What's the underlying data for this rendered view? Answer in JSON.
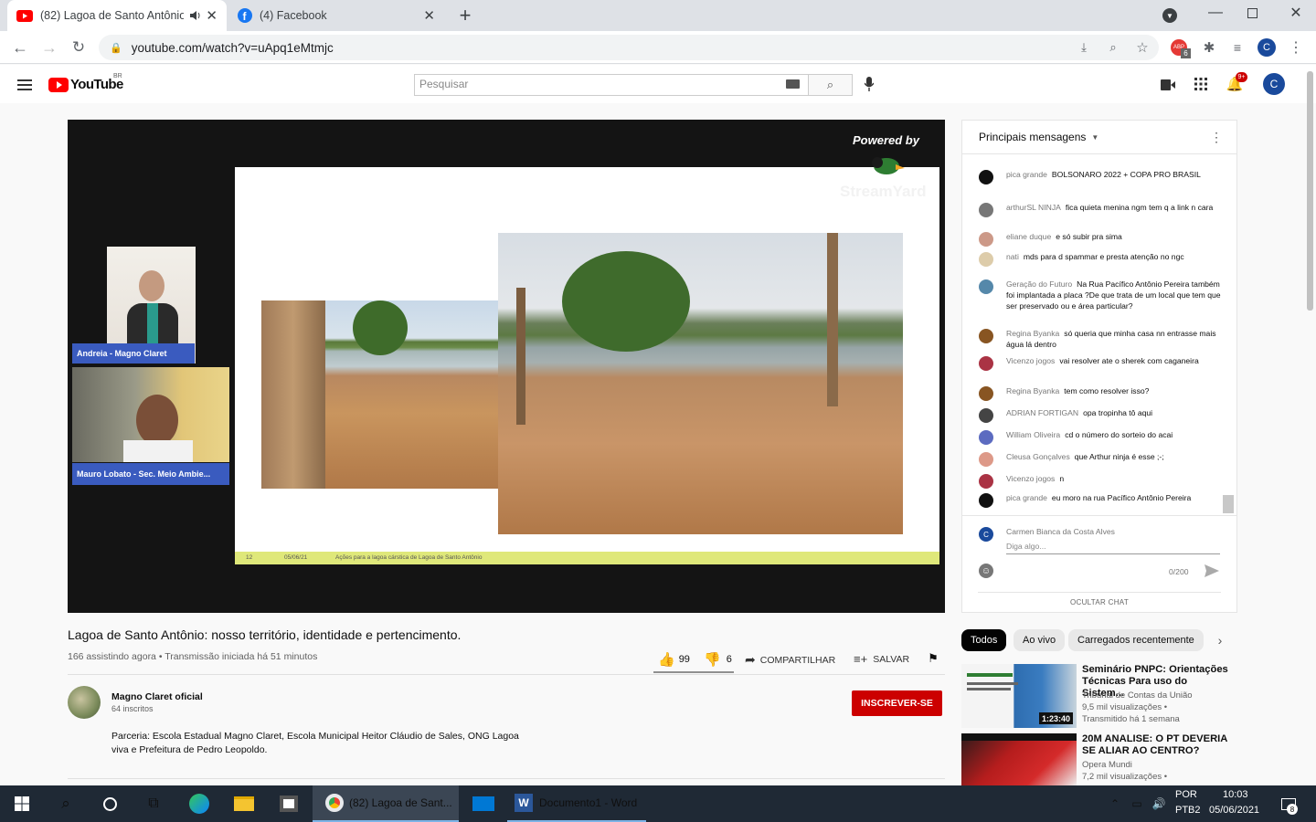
{
  "browser": {
    "tabs": [
      {
        "title": "(82) Lagoa de Santo Antônio",
        "icon": "youtube-icon"
      },
      {
        "title": "(4) Facebook",
        "icon": "facebook-icon"
      }
    ],
    "url": "youtube.com/watch?v=uApq1eMtmjc",
    "profile_initial": "C",
    "ext_badge": "6"
  },
  "yt": {
    "logo_text": "YouTube",
    "region": "BR",
    "search_placeholder": "Pesquisar",
    "notif_count": "9+",
    "avatar_initial": "C"
  },
  "player": {
    "powered_by": "Powered by",
    "streamyard": "StreamYard",
    "guest1": "Andreia - Magno Claret",
    "guest2": "Mauro Lobato - Sec. Meio Ambie...",
    "slide_page": "12",
    "slide_date": "05/06/21",
    "slide_caption": "Ações para a lagoa cárstica de Lagoa de Santo Antônio"
  },
  "video": {
    "title": "Lagoa de Santo Antônio: nosso território, identidade e pertencimento.",
    "meta": "166 assistindo agora • Transmissão iniciada há 51 minutos",
    "likes": "99",
    "dislikes": "6",
    "share": "COMPARTILHAR",
    "save": "SALVAR",
    "channel": "Magno Claret oficial",
    "subs": "64 inscritos",
    "subscribe": "INSCREVER-SE",
    "desc1": "Parceria: Escola Estadual Magno Claret, Escola Municipal  Heitor Cláudio de Sales, ONG Lagoa",
    "desc2": "viva e Prefeitura de Pedro Leopoldo."
  },
  "chat": {
    "header": "Principais mensagens",
    "messages": [
      {
        "author": "pica grande",
        "text": "BOLSONARO 2022 + COPA PRO BRASIL",
        "color": "#111"
      },
      {
        "author": "arthurSL NINJA",
        "text": "fica quieta menina ngm tem q a link n cara",
        "color": "#777"
      },
      {
        "author": "eliane duque",
        "text": "e só subir pra sima",
        "color": "#c98"
      },
      {
        "author": "nati",
        "text": "mds para d spammar e presta atenção no ngc",
        "color": "#dca"
      },
      {
        "author": "Geração do Futuro",
        "text": "Na Rua Pacífico Antônio Pereira também foi implantada a placa ?De que trata de um local que tem que ser preservado ou e área particular?",
        "color": "#58a"
      },
      {
        "author": "Regina Byanka",
        "text": "só queria que minha casa nn entrasse mais água lá dentro",
        "color": "#852"
      },
      {
        "author": "Vicenzo jogos",
        "text": "vai resolver ate o sherek com caganeira",
        "color": "#a34"
      },
      {
        "author": "Regina Byanka",
        "text": "tem como resolver isso?",
        "color": "#852"
      },
      {
        "author": "ADRIAN FORTIGAN",
        "text": "opa tropinha tô aqui",
        "color": "#444"
      },
      {
        "author": "William Oliveira",
        "text": "cd o número do sorteio do acai",
        "color": "#5c6bc0"
      },
      {
        "author": "Cleusa Gonçalves",
        "text": "que Arthur ninja é esse ;-;",
        "color": "#d98"
      },
      {
        "author": "Vicenzo jogos",
        "text": "n",
        "color": "#a34"
      },
      {
        "author": "pica grande",
        "text": "eu moro na rua Pacífico Antônio Pereira",
        "color": "#111"
      }
    ],
    "me": "Carmen Bianca da Costa Alves",
    "input_placeholder": "Diga algo...",
    "counter": "0/200",
    "hide": "OCULTAR CHAT"
  },
  "chips": [
    "Todos",
    "Ao vivo",
    "Carregados recentemente"
  ],
  "recs": [
    {
      "title": "Seminário PNPC: Orientações Técnicas Para uso do Sistem...",
      "channel": "Tribunal de Contas da União",
      "views": "9,5 mil visualizações •",
      "when": "Transmitido há 1 semana",
      "duration": "1:23:40"
    },
    {
      "title": "20M ANALISE: O PT DEVERIA SE ALIAR AO CENTRO?",
      "channel": "Opera Mundi",
      "views": "7,2 mil visualizações •",
      "when": ""
    }
  ],
  "taskbar": {
    "apps": [
      {
        "label": "(82) Lagoa de Sant..."
      },
      {
        "label": "Documento1 - Word"
      }
    ],
    "lang1": "POR",
    "lang2": "PTB2",
    "time": "10:03",
    "date": "05/06/2021",
    "notif": "8"
  }
}
